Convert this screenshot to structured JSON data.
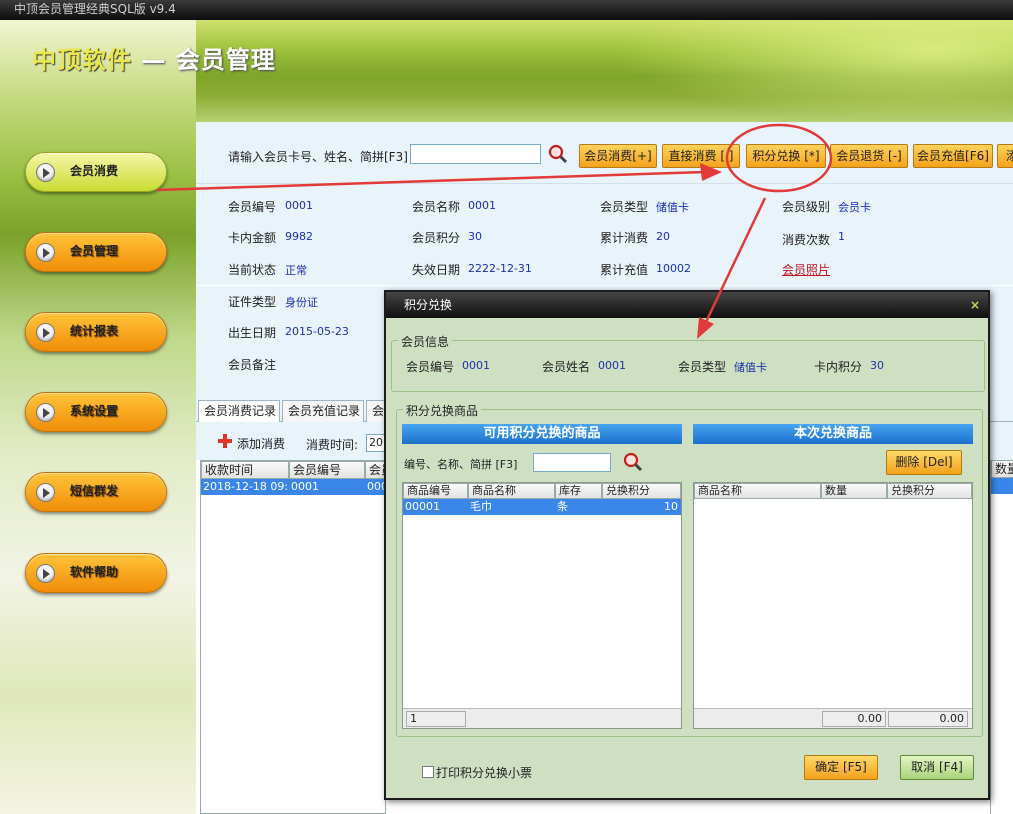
{
  "window": {
    "title": "中顶会员管理经典SQL版 v9.4"
  },
  "brand": {
    "company": "中顶软件",
    "module": " — 会员管理"
  },
  "nav": [
    {
      "label": "会员消费",
      "active": true
    },
    {
      "label": "会员管理"
    },
    {
      "label": "统计报表"
    },
    {
      "label": "系统设置"
    },
    {
      "label": "短信群发"
    },
    {
      "label": "软件帮助"
    }
  ],
  "search": {
    "label": "请输入会员卡号、姓名、简拼[F3]",
    "value": ""
  },
  "toolbar": [
    "会员消费[+]",
    "直接消费 [ ]",
    "积分兑换 [*]",
    "会员退货 [-]",
    "会员充值[F6]",
    "添"
  ],
  "member": {
    "id_label": "会员编号",
    "id": "0001",
    "name_label": "会员名称",
    "name": "0001",
    "type_label": "会员类型",
    "type": "储值卡",
    "level_label": "会员级别",
    "level": "会员卡",
    "balance_label": "卡内金额",
    "balance": "9982",
    "points_label": "会员积分",
    "points": "30",
    "total_spend_label": "累计消费",
    "total_spend": "20",
    "visits_label": "消费次数",
    "visits": "1",
    "status_label": "当前状态",
    "status": "正常",
    "expire_label": "失效日期",
    "expire": "2222-12-31",
    "total_recharge_label": "累计充值",
    "total_recharge": "10002",
    "photo_link": "会员照片",
    "idtype_label": "证件类型",
    "idtype": "身份证",
    "birth_label": "出生日期",
    "birth": "2015-05-23",
    "note_label": "会员备注",
    "note": ""
  },
  "tabs": [
    "会员消费记录",
    "会员充值记录",
    "会"
  ],
  "records": {
    "add_label": "添加消费",
    "time_label": "消费时间:",
    "time_value": "20",
    "columns": [
      "收款时间",
      "会员编号",
      "会员"
    ],
    "right_col": "数量",
    "rows": [
      [
        "2018-12-18 09:",
        "0001",
        "000"
      ]
    ]
  },
  "dialog": {
    "title": "积分兑换",
    "close": "×",
    "member_group": "会员信息",
    "member_id_label": "会员编号",
    "member_id": "0001",
    "member_name_label": "会员姓名",
    "member_name": "0001",
    "member_type_label": "会员类型",
    "member_type": "储值卡",
    "card_points_label": "卡内积分",
    "card_points": "30",
    "goods_group": "积分兑换商品",
    "available_title": "可用积分兑换的商品",
    "current_title": "本次兑换商品",
    "search_label": "编号、名称、简拼 [F3]",
    "delete_btn": "删除 [Del]",
    "left_columns": [
      "商品编号",
      "商品名称",
      "库存",
      "兑换积分"
    ],
    "left_rows": [
      [
        "00001",
        "毛巾",
        "条",
        "10"
      ]
    ],
    "right_columns": [
      "商品名称",
      "数量",
      "兑换积分"
    ],
    "left_footer": "1",
    "right_footer_qty": "0.00",
    "right_footer_points": "0.00",
    "print_label": "打印积分兑换小票",
    "ok_btn": "确定 [F5]",
    "cancel_btn": "取消 [F4]"
  }
}
